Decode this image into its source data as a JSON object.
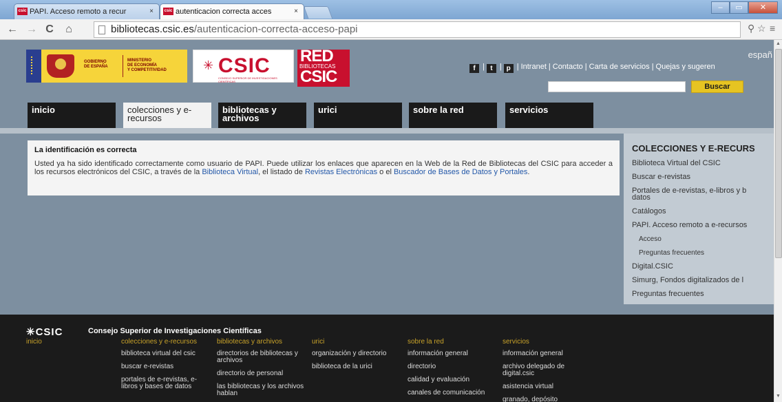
{
  "browser": {
    "tabs": [
      {
        "favicon": "csic",
        "title": "PAPI. Acceso remoto a recur",
        "close": "×"
      },
      {
        "favicon": "csic",
        "title": "autenticacion correcta acces",
        "close": "×"
      }
    ],
    "window_buttons": {
      "minimize": "–",
      "maximize": "▭",
      "close": "✕"
    },
    "back": "←",
    "forward": "→",
    "reload": "C",
    "home": "⌂",
    "url_host": "bibliotecas.csic.es",
    "url_path": "/autenticacion-correcta-acceso-papi",
    "toolbar_right": {
      "ext": "⚲",
      "star": "☆",
      "menu": "≡"
    }
  },
  "header": {
    "gov_text1": "GOBIERNO\nDE ESPAÑA",
    "gov_text2": "MINISTERIO\nDE ECONOMÍA\nY COMPETITIVIDAD",
    "csic_word": "CSIC",
    "csic_mark": "✳",
    "csic_sub": "CONSEJO SUPERIOR DE INVESTIGACIONES CIENTÍFICAS",
    "red_1": "RED",
    "red_2": "BIBLIOTECAS",
    "red_3": "CSIC",
    "language": "españ",
    "social": [
      "f",
      "t",
      "p"
    ],
    "links": [
      "Intranet",
      "Contacto",
      "Carta de servicios",
      "Quejas y sugeren"
    ],
    "search_placeholder": "",
    "search_button": "Buscar"
  },
  "mainnav": [
    {
      "label": "inicio"
    },
    {
      "label": "colecciones y e-recursos"
    },
    {
      "label": "bibliotecas y archivos"
    },
    {
      "label": "urici"
    },
    {
      "label": "sobre la red"
    },
    {
      "label": "servicios"
    }
  ],
  "content": {
    "title": "La identificación es correcta",
    "p_text1": "Usted ya ha sido identificado correctamente como usuario de PAPI. Puede utilizar los enlaces que aparecen en la Web de la Red de Bibliotecas del CSIC para acceder a los recursos electrónicos del CSIC, a través de la ",
    "link1": "Biblioteca Virtual",
    "p_text2": ", el listado de ",
    "link2": "Revistas Electrónicas",
    "p_text3": " o el ",
    "link3": "Buscador de Bases de Datos y Portales",
    "p_text4": "."
  },
  "sidebar": {
    "title": "COLECCIONES Y E-RECURS",
    "items": [
      {
        "label": "Biblioteca Virtual del CSIC"
      },
      {
        "label": "Buscar e-revistas"
      },
      {
        "label": "Portales de e-revistas, e-libros y b"
      },
      {
        "label": "datos"
      },
      {
        "label": "Catálogos"
      },
      {
        "label": "PAPI. Acceso remoto a e-recursos"
      },
      {
        "label": "Acceso"
      },
      {
        "label": "Preguntas frecuentes"
      },
      {
        "label": "Digital.CSIC"
      },
      {
        "label": "Simurg, Fondos digitalizados de l"
      },
      {
        "label": "Preguntas frecuentes"
      }
    ]
  },
  "footer": {
    "brand": "CSIC",
    "brand_mark": "✳",
    "brand_sub": "Consejo Superior de Investigaciones Científicas",
    "columns": [
      {
        "heading": "inicio",
        "links": []
      },
      {
        "heading": "colecciones y e-recursos",
        "links": [
          "biblioteca virtual del csic",
          "buscar e-revistas",
          "portales de e-revistas, e-libros y bases de datos"
        ]
      },
      {
        "heading": "bibliotecas y archivos",
        "links": [
          "directorios de bibliotecas y archivos",
          "directorio de personal",
          "las bibliotecas y los archivos hablan"
        ]
      },
      {
        "heading": "urici",
        "links": [
          "organización y directorio",
          "biblioteca de la urici"
        ]
      },
      {
        "heading": "sobre la red",
        "links": [
          "información general",
          "directorio",
          "calidad y evaluación",
          "canales de comunicación"
        ]
      },
      {
        "heading": "servicios",
        "links": [
          "información general",
          "archivo delegado de digital.csic",
          "asistencia virtual",
          "granado, depósito cooperativo de"
        ]
      }
    ]
  }
}
